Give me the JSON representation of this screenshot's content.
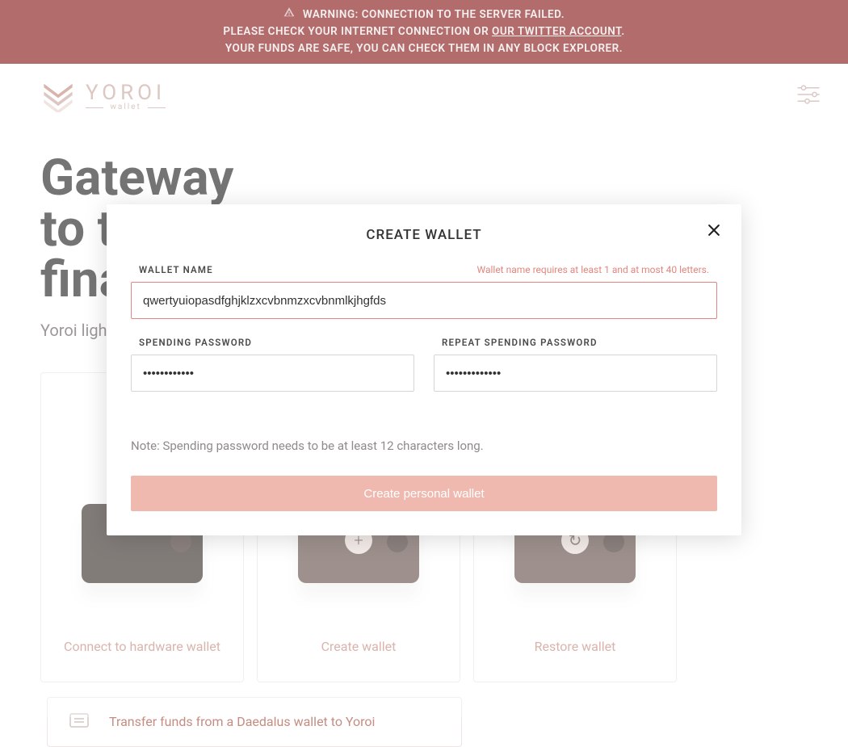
{
  "banner": {
    "line1": "WARNING: CONNECTION TO THE SERVER FAILED.",
    "line2_prefix": "PLEASE CHECK YOUR INTERNET CONNECTION OR ",
    "line2_link": "OUR TWITTER ACCOUNT",
    "line2_suffix": ".",
    "line3": "YOUR FUNDS ARE SAFE, YOU CAN CHECK THEM IN ANY BLOCK EXPLORER."
  },
  "brand": {
    "wordmark": "YOROI",
    "subline": "wallet"
  },
  "hero": {
    "title_line1": "Gateway",
    "title_line2": "to the",
    "title_line3": "financial world",
    "subtitle": "Yoroi light wallet for Cardano assets"
  },
  "cards": {
    "connect": "Connect to hardware wallet",
    "create": "Create wallet",
    "restore": "Restore wallet",
    "transfer": "Transfer funds from a Daedalus wallet to Yoroi"
  },
  "modal": {
    "title": "CREATE WALLET",
    "wallet_name_label": "WALLET NAME",
    "wallet_name_value": "qwertyuiopasdfghjklzxcvbnmzxcvbnmlkjhgfds",
    "wallet_name_error": "Wallet name requires at least 1 and at most 40 letters.",
    "spending_pwd_label": "SPENDING PASSWORD",
    "spending_pwd_value": "••••••••••••",
    "repeat_pwd_label": "REPEAT SPENDING PASSWORD",
    "repeat_pwd_value": "•••••••••••••",
    "note": "Note: Spending password needs to be at least 12 characters long.",
    "submit": "Create personal wallet"
  },
  "icons": {
    "warning": "warning-triangle-icon",
    "settings": "sliders-icon",
    "close": "close-icon",
    "logo": "yoroi-logo-icon",
    "transfer": "transfer-icon"
  },
  "colors": {
    "banner_bg": "#8b1e1e",
    "accent": "#c58d82",
    "error": "#e2867f",
    "button": "#f0b9b0"
  }
}
